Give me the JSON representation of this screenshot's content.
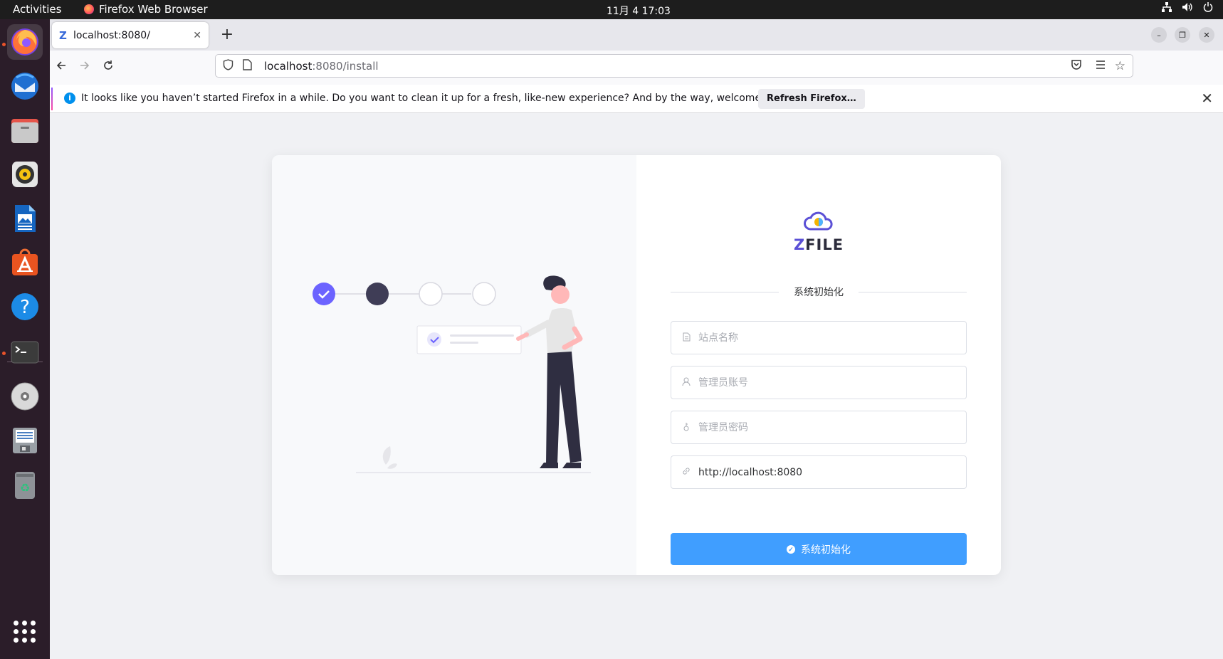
{
  "system": {
    "activities": "Activities",
    "app_name": "Firefox Web Browser",
    "clock": "11月 4  17:03"
  },
  "dock": {
    "items": [
      "firefox-icon",
      "thunderbird-icon",
      "files-icon",
      "rhythmbox-icon",
      "writer-icon",
      "software-icon",
      "help-icon",
      "terminal-icon",
      "dvd-icon",
      "floppy-icon",
      "trash-icon"
    ]
  },
  "browser": {
    "tab": {
      "title": "localhost:8080/",
      "favicon": "Z"
    },
    "url": {
      "host": "localhost",
      "path": ":8080/install"
    },
    "notice": {
      "message": "It looks like you haven’t started Firefox in a while. Do you want to clean it up for a fresh, like-new experience? And by the way, welcome back!",
      "button": "Refresh Firefox…"
    }
  },
  "page": {
    "logo_text_z": "Z",
    "logo_text_rest": "FILE",
    "heading": "系统初始化",
    "fields": [
      {
        "name": "site-name",
        "placeholder": "站点名称",
        "value": "",
        "icon": "document-icon"
      },
      {
        "name": "admin-account",
        "placeholder": "管理员账号",
        "value": "",
        "icon": "user-icon"
      },
      {
        "name": "admin-password",
        "placeholder": "管理员密码",
        "value": "",
        "icon": "key-icon"
      },
      {
        "name": "domain",
        "placeholder": "",
        "value": "http://localhost:8080",
        "icon": "link-icon"
      }
    ],
    "submit_label": "系统初始化"
  },
  "colors": {
    "accent": "#409eff",
    "step_done": "#6c63ff",
    "step_current": "#3f3d56"
  }
}
